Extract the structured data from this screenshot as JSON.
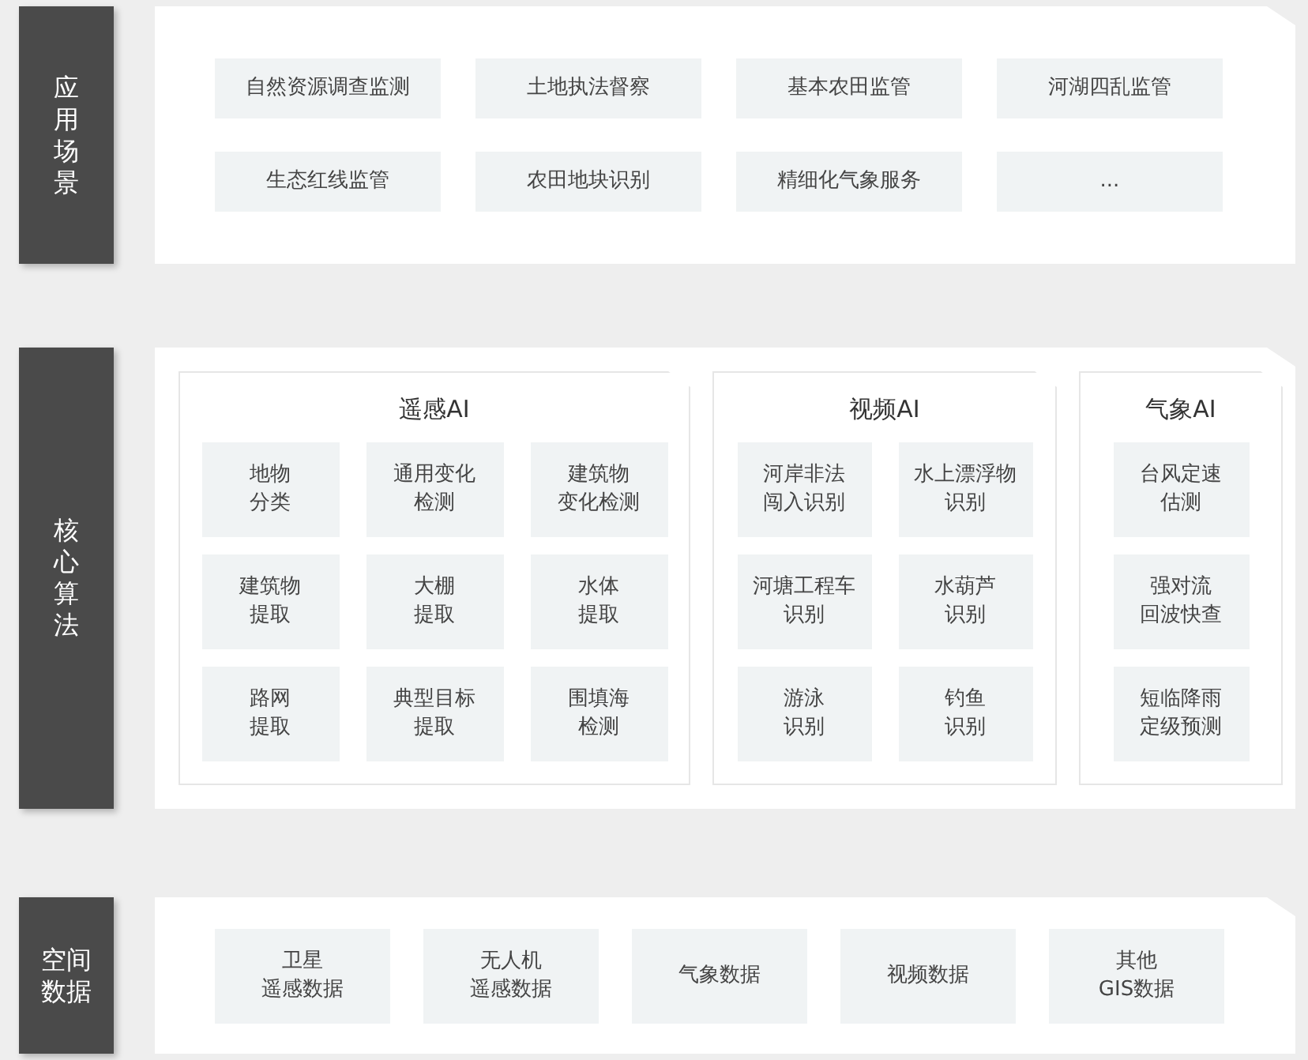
{
  "layers": [
    {
      "label": "应用场景",
      "kind": "grid",
      "items": [
        [
          "自然资源调查监测"
        ],
        [
          "土地执法督察"
        ],
        [
          "基本农田监管"
        ],
        [
          "河湖四乱监管"
        ],
        [
          "生态红线监管"
        ],
        [
          "农田地块识别"
        ],
        [
          "精细化气象服务"
        ],
        [
          "..."
        ]
      ]
    },
    {
      "label": "核心算法",
      "kind": "groups",
      "groups": [
        {
          "title": "遥感AI",
          "items": [
            [
              "地物",
              "分类"
            ],
            [
              "通用变化",
              "检测"
            ],
            [
              "建筑物",
              "变化检测"
            ],
            [
              "建筑物",
              "提取"
            ],
            [
              "大棚",
              "提取"
            ],
            [
              "水体",
              "提取"
            ],
            [
              "路网",
              "提取"
            ],
            [
              "典型目标",
              "提取"
            ],
            [
              "围填海",
              "检测"
            ]
          ]
        },
        {
          "title": "视频AI",
          "items": [
            [
              "河岸非法",
              "闯入识别"
            ],
            [
              "水上漂浮物",
              "识别"
            ],
            [
              "河塘工程车",
              "识别"
            ],
            [
              "水葫芦",
              "识别"
            ],
            [
              "游泳",
              "识别"
            ],
            [
              "钓鱼",
              "识别"
            ]
          ]
        },
        {
          "title": "气象AI",
          "items": [
            [
              "台风定速",
              "估测"
            ],
            [
              "强对流",
              "回波快查"
            ],
            [
              "短临降雨",
              "定级预测"
            ]
          ]
        }
      ]
    },
    {
      "label": "空间数据",
      "kind": "grid",
      "items": [
        [
          "卫星",
          "遥感数据"
        ],
        [
          "无人机",
          "遥感数据"
        ],
        [
          "气象数据"
        ],
        [
          "视频数据"
        ],
        [
          "其他",
          "GIS数据"
        ]
      ]
    }
  ]
}
